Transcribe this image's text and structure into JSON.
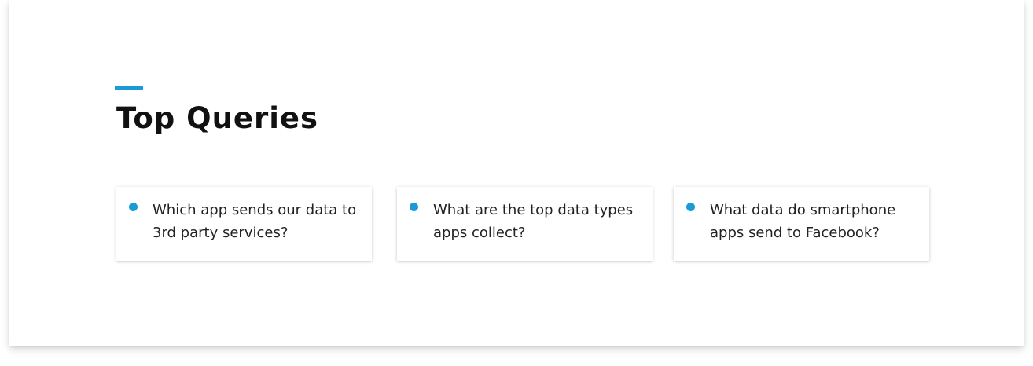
{
  "section": {
    "title": "Top Queries",
    "accent_color": "#1a9bd7"
  },
  "queries": [
    {
      "text": "Which app sends our data to 3rd party services?"
    },
    {
      "text": "What are the top data types apps collect?"
    },
    {
      "text": "What data do smartphone apps send to Facebook?"
    }
  ]
}
